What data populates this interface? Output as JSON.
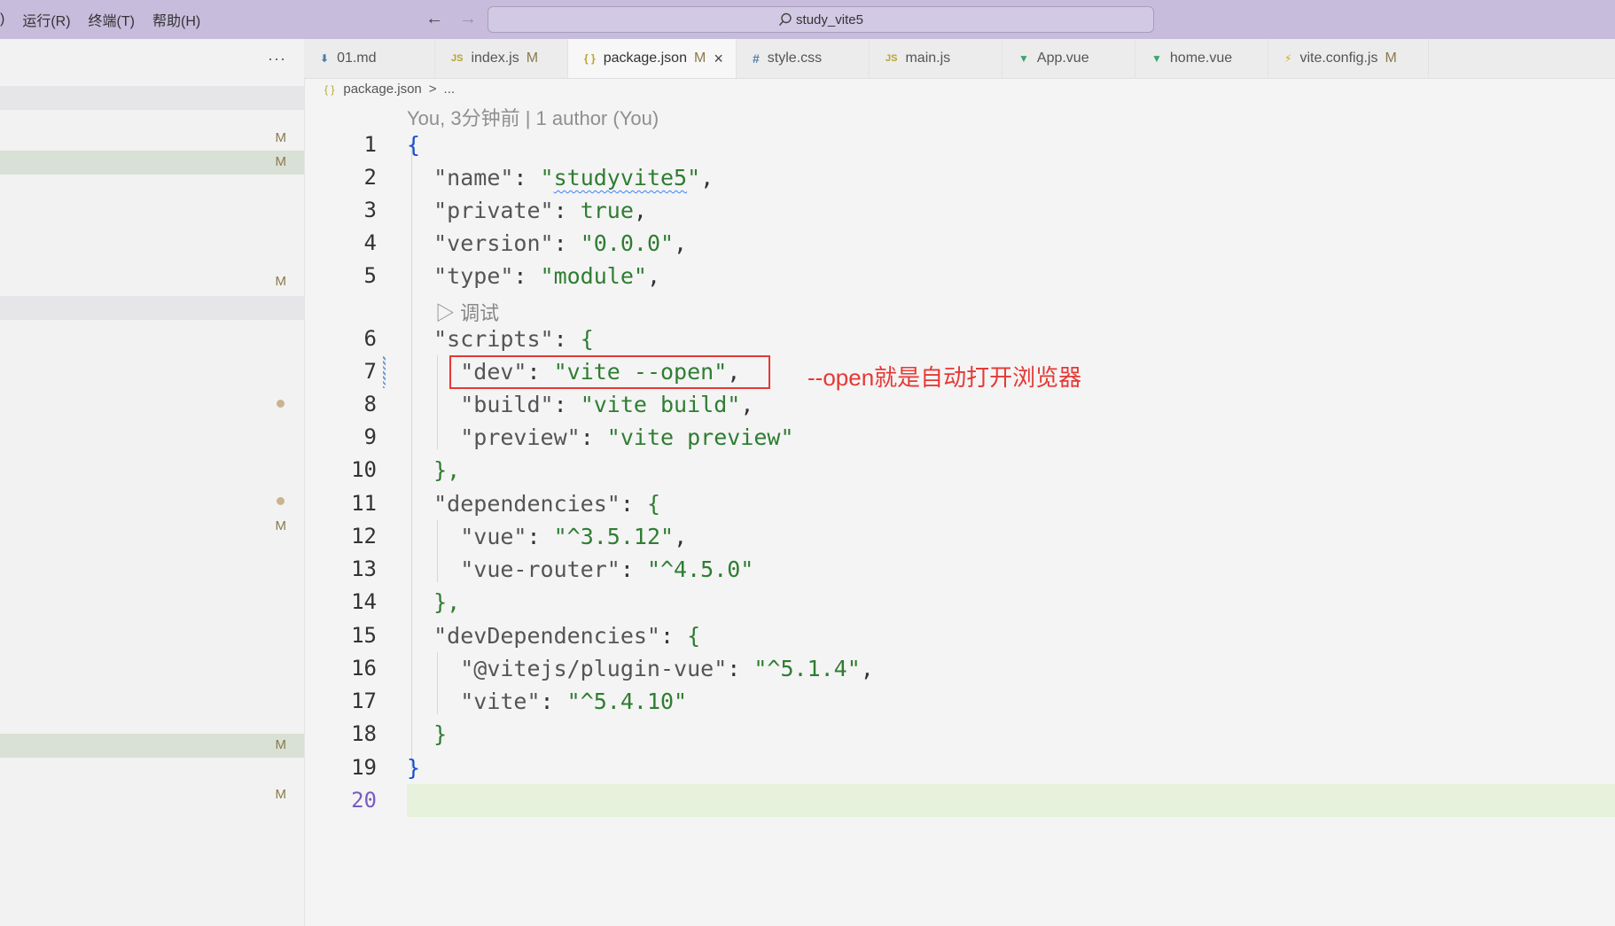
{
  "menu": {
    "partial_paren": ")",
    "items": [
      "运行(R)",
      "终端(T)",
      "帮助(H)"
    ]
  },
  "nav": {
    "back": "←",
    "forward": "→"
  },
  "search": {
    "text": "study_vite5"
  },
  "sidebar": {
    "more": "···",
    "badges": [
      "M",
      "M",
      "M",
      "M",
      "M",
      "M"
    ]
  },
  "tabs": [
    {
      "label": "01.md",
      "icon": "markdown-icon",
      "modified": ""
    },
    {
      "label": "index.js",
      "icon": "js-icon",
      "modified": "M"
    },
    {
      "label": "package.json",
      "icon": "json-icon",
      "modified": "M",
      "close": "×"
    },
    {
      "label": "style.css",
      "icon": "css-icon",
      "modified": ""
    },
    {
      "label": "main.js",
      "icon": "js-icon",
      "modified": ""
    },
    {
      "label": "App.vue",
      "icon": "vue-icon",
      "modified": ""
    },
    {
      "label": "home.vue",
      "icon": "vue-icon",
      "modified": ""
    },
    {
      "label": "vite.config.js",
      "icon": "vite-icon",
      "modified": "M"
    }
  ],
  "breadcrumb": {
    "file": "package.json",
    "sep": ">",
    "rest": "..."
  },
  "editor": {
    "blame": "You, 3分钟前 | 1 author (You)",
    "codelens": "▷ 调试",
    "line_numbers": [
      "1",
      "2",
      "3",
      "4",
      "5",
      "6",
      "7",
      "8",
      "9",
      "10",
      "11",
      "12",
      "13",
      "14",
      "15",
      "16",
      "17",
      "18",
      "19",
      "20"
    ],
    "annotation": "--open就是自动打开浏览器",
    "code": {
      "l1": "{",
      "l2_key": "\"name\"",
      "l2_val": "studyvite5",
      "l3_key": "\"private\"",
      "l3_val": "true",
      "l4_key": "\"version\"",
      "l4_val": "\"0.0.0\"",
      "l5_key": "\"type\"",
      "l5_val": "\"module\"",
      "l6_key": "\"scripts\"",
      "l7_key": "\"dev\"",
      "l7_val": "\"vite --open\"",
      "l8_key": "\"build\"",
      "l8_val": "\"vite build\"",
      "l9_key": "\"preview\"",
      "l9_val": "\"vite preview\"",
      "l10": "},",
      "l11_key": "\"dependencies\"",
      "l12_key": "\"vue\"",
      "l12_val": "\"^3.5.12\"",
      "l13_key": "\"vue-router\"",
      "l13_val": "\"^4.5.0\"",
      "l14": "},",
      "l15_key": "\"devDependencies\"",
      "l16_key": "\"@vitejs/plugin-vue\"",
      "l16_val": "\"^5.1.4\"",
      "l17_key": "\"vite\"",
      "l17_val": "\"^5.4.10\"",
      "l18": "}",
      "l19": "}"
    }
  }
}
